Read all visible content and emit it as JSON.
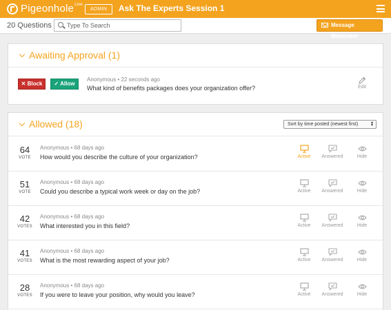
{
  "header": {
    "brand": "Pigeonhole",
    "brand_sup": "Live",
    "admin_badge": "ADMIN",
    "session_title": "Ask The Experts Session 1"
  },
  "toolbar": {
    "question_count": "20 Questions",
    "search_placeholder": "Type To Search",
    "message_button": "Message Moderator"
  },
  "awaiting": {
    "title": "Awaiting Approval (1)",
    "block_label": "Block",
    "allow_label": "Allow",
    "item": {
      "author": "Anonymous",
      "time": "22 seconds ago",
      "text": "What kind of benefits packages does your organization offer?"
    },
    "edit_label": "Edit"
  },
  "allowed": {
    "title": "Allowed (18)",
    "sort_label": "Sort by time posted (newest first)",
    "action_labels": {
      "active": "Active",
      "answered": "Answered",
      "hide": "Hide"
    },
    "questions": [
      {
        "votes": "64",
        "vote_word": "VOTE",
        "author": "Anonymous",
        "time": "68 days ago",
        "text": "How would you describe the culture of your organization?",
        "active": true
      },
      {
        "votes": "51",
        "vote_word": "VOTE",
        "author": "Anonymous",
        "time": "68 days ago",
        "text": "Could you describe a typical work week or day on the job?",
        "active": false
      },
      {
        "votes": "42",
        "vote_word": "VOTES",
        "author": "Anonymous",
        "time": "68 days ago",
        "text": "What interested you in this field?",
        "active": false
      },
      {
        "votes": "41",
        "vote_word": "VOTES",
        "author": "Anonymous",
        "time": "68 days ago",
        "text": "What is the most rewarding aspect of your job?",
        "active": false
      },
      {
        "votes": "28",
        "vote_word": "VOTES",
        "author": "Anonymous",
        "time": "68 days ago",
        "text": "If you were to leave your position, why would you leave?",
        "active": false
      }
    ]
  },
  "colors": {
    "accent": "#f4a31f",
    "block": "#c9302c",
    "allow": "#1aa37a"
  }
}
